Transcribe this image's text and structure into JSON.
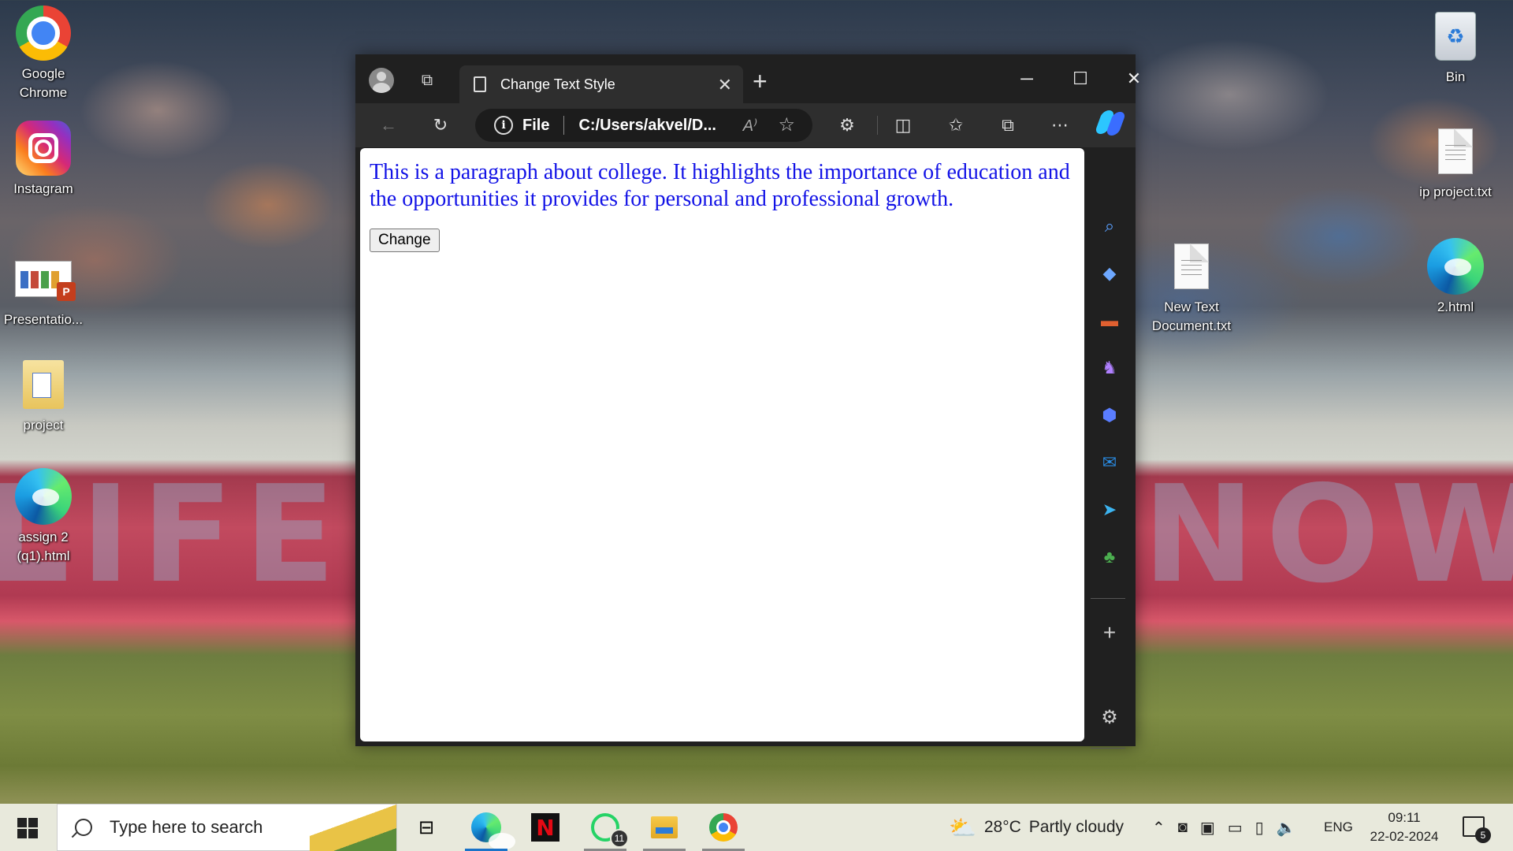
{
  "desktop": {
    "icons": [
      {
        "label": "Google Chrome"
      },
      {
        "label": "Instagram"
      },
      {
        "label": "Presentatio..."
      },
      {
        "label": "project"
      },
      {
        "label": "assign 2 (q1).html"
      },
      {
        "label": "Bin"
      },
      {
        "label": "ip project.txt"
      },
      {
        "label": "New Text Document.txt"
      },
      {
        "label": "2.html"
      }
    ]
  },
  "browser": {
    "tab_title": "Change Text Style",
    "address": {
      "scheme_label": "File",
      "url": "C:/Users/akvel/D..."
    },
    "page": {
      "paragraph": "This is a paragraph about college. It highlights the importance of education and the opportunities it provides for personal and professional growth.",
      "paragraph_color": "#1212e6",
      "button_label": "Change"
    }
  },
  "taskbar": {
    "search_placeholder": "Type here to search",
    "weather": {
      "temp": "28°C",
      "condition": "Partly cloudy"
    },
    "language": "ENG",
    "time": "09:11",
    "date": "22-02-2024",
    "whatsapp_badge": "11",
    "notification_count": "5"
  }
}
